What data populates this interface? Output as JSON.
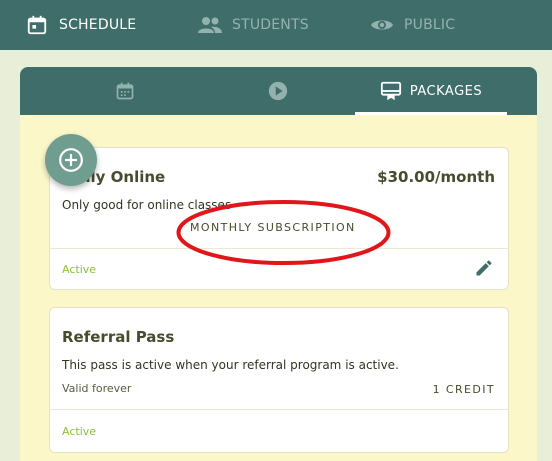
{
  "nav": {
    "schedule": {
      "label": "SCHEDULE",
      "icon": "calendar-icon"
    },
    "students": {
      "label": "STUDENTS",
      "icon": "people-icon"
    },
    "public": {
      "label": "PUBLIC",
      "icon": "eye-icon"
    }
  },
  "tabs": {
    "calendar": {
      "icon": "calendar-icon"
    },
    "video": {
      "icon": "play-icon"
    },
    "packages": {
      "label": "PACKAGES",
      "icon": "card-icon"
    }
  },
  "packages": [
    {
      "title": "nthly Online",
      "price": "$30.00/month",
      "description": "Only good for online classes",
      "type": "MONTHLY SUBSCRIPTION",
      "status": "Active"
    },
    {
      "title": "Referral Pass",
      "description": "This pass is active when your referral program is active.",
      "validity": "Valid forever",
      "credits": "1 CREDIT",
      "status": "Active"
    }
  ],
  "colors": {
    "header": "#3f6e6a",
    "panel": "#fbf7c9",
    "status": "#8bbd3f",
    "annotation": "#e0161b",
    "fab": "#6f9d8f"
  }
}
